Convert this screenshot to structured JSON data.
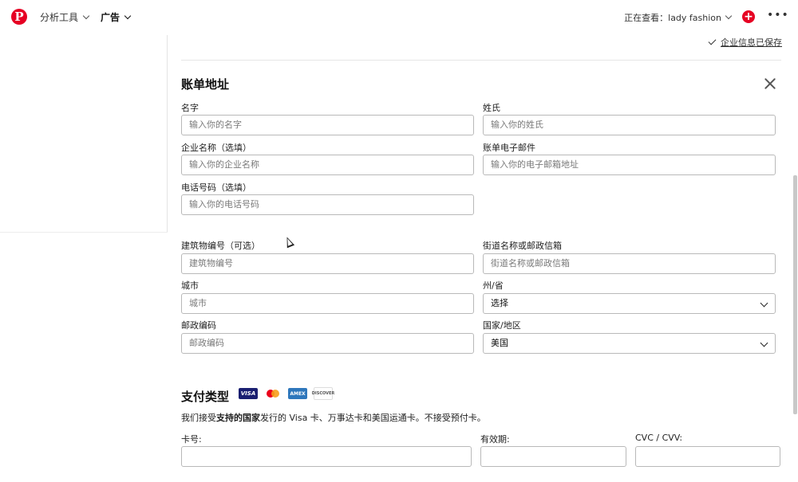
{
  "topbar": {
    "logo": "P",
    "analytics": "分析工具",
    "ads": "广告",
    "viewing": "正在查看：lady fashion",
    "plus": "+",
    "more": "•••"
  },
  "saved_text": "企业信息已保存",
  "billing": {
    "title": "账单地址",
    "first_name": {
      "label": "名字",
      "placeholder": "输入你的名字"
    },
    "last_name": {
      "label": "姓氏",
      "placeholder": "输入你的姓氏"
    },
    "company": {
      "label": "企业名称（选填）",
      "placeholder": "输入你的企业名称"
    },
    "email": {
      "label": "账单电子邮件",
      "placeholder": "输入你的电子邮箱地址"
    },
    "phone": {
      "label": "电话号码（选填）",
      "placeholder": "输入你的电话号码"
    },
    "building": {
      "label": "建筑物编号（可选）",
      "placeholder": "建筑物编号"
    },
    "street": {
      "label": "街道名称或邮政信箱",
      "placeholder": "街道名称或邮政信箱"
    },
    "city": {
      "label": "城市",
      "placeholder": "城市"
    },
    "state": {
      "label": "州/省",
      "value": "选择"
    },
    "zip": {
      "label": "邮政编码",
      "placeholder": "邮政编码"
    },
    "country": {
      "label": "国家/地区",
      "value": "美国"
    }
  },
  "payment": {
    "title": "支付类型",
    "cards": {
      "visa": "VISA",
      "amex": "AMEX",
      "discover": "DISCOVER"
    },
    "note_pre": "我们接受",
    "note_bold": "支持的国家",
    "note_post": "发行的 Visa 卡、万事达卡和美国运通卡。不接受预付卡。",
    "card_number_label": "卡号:",
    "expiry_label": "有效期:",
    "cvc_label": "CVC / CVV:"
  }
}
